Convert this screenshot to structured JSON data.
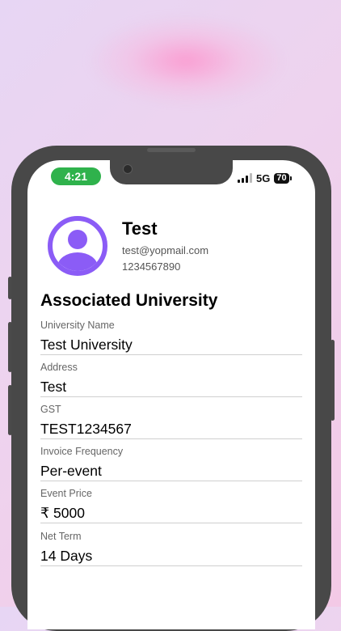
{
  "status_bar": {
    "time": "4:21",
    "network": "5G",
    "battery": "70",
    "time_pill_color": "#2fb24c"
  },
  "profile": {
    "name": "Test",
    "email": "test@yopmail.com",
    "phone": "1234567890",
    "avatar_icon": "user-avatar-icon",
    "avatar_color": "#8b5cf6"
  },
  "university": {
    "section_title": "Associated University",
    "fields": [
      {
        "label": "University Name",
        "value": "Test University"
      },
      {
        "label": "Address",
        "value": "Test"
      },
      {
        "label": "GST",
        "value": "TEST1234567"
      },
      {
        "label": "Invoice Frequency",
        "value": "Per-event"
      },
      {
        "label": "Event Price",
        "value": "₹ 5000"
      },
      {
        "label": "Net Term",
        "value": "14 Days"
      }
    ]
  }
}
